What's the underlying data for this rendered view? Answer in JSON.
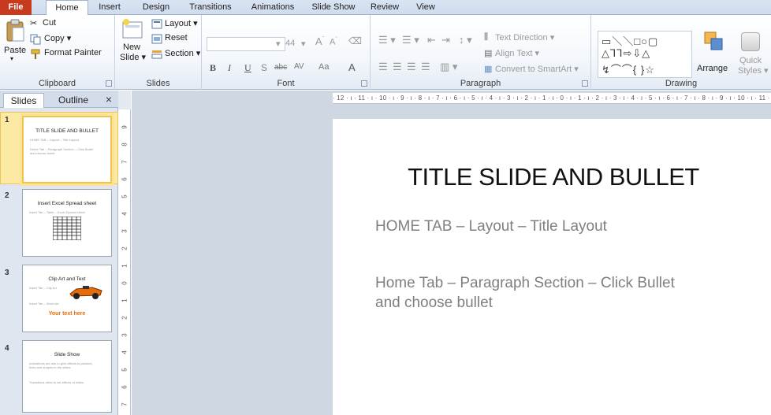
{
  "tabs": [
    "File",
    "Home",
    "Insert",
    "Design",
    "Transitions",
    "Animations",
    "Slide Show",
    "Review",
    "View"
  ],
  "ribbon": {
    "clipboard": {
      "label": "Clipboard",
      "paste": "Paste",
      "cut": "Cut",
      "copy": "Copy ▾",
      "format_painter": "Format Painter"
    },
    "slides": {
      "label": "Slides",
      "new_slide_1": "New",
      "new_slide_2": "Slide ▾",
      "layout": "Layout ▾",
      "reset": "Reset",
      "section": "Section ▾"
    },
    "font": {
      "label": "Font",
      "size": "44",
      "bold": "B",
      "italic": "I",
      "underline": "U",
      "shadow": "S",
      "strike": "abc",
      "spacing": "AV",
      "case": "Aa",
      "color": "A"
    },
    "paragraph": {
      "label": "Paragraph",
      "text_direction": "Text Direction ▾",
      "align_text": "Align Text ▾",
      "convert_smartart": "Convert to SmartArt ▾"
    },
    "drawing": {
      "label": "Drawing",
      "arrange": "Arrange",
      "quick_styles_1": "Quick",
      "quick_styles_2": "Styles ▾"
    }
  },
  "pane": {
    "tab_slides": "Slides",
    "tab_outline": "Outline",
    "close": "×",
    "thumbnails": [
      {
        "num": "1",
        "title": "TITLE SLIDE AND BULLET",
        "line1": "HOME TAB – Layout – Title Layout",
        "line2": "Home Tab – Paragraph Section – Click Bullet",
        "line3": "and choose bullet"
      },
      {
        "num": "2",
        "title": "Insert Excel Spread sheet",
        "line1": "Insert Tab – Table – Excel Spread sheet"
      },
      {
        "num": "3",
        "title": "Clip Art and Text",
        "line1": "Insert Tab – Clip Art",
        "line2": "Insert Tab – Word Art",
        "wordart": "Your text here"
      },
      {
        "num": "4",
        "title": "Slide Show",
        "line1": "Animations are use to give effects to pictures,",
        "line2": "texts and shapes in the slides",
        "line3": "Transitions allow to set effects of slides"
      }
    ]
  },
  "ruler": {
    "horizontal": "· 12 · ı · 11 · ı · 10 · ı · 9 · ı · 8 · ı · 7 · ı · 6 · ı · 5 · ı · 4 · ı · 3 · ı · 2 · ı · 1 · ı · 0 · ı · 1 · ı · 2 · ı · 3 · ı · 4 · ı · 5 · ı · 6 · ı · 7 · ı · 8 · ı · 9 · ı · 10 · ı · 11 ·",
    "vertical": [
      "9",
      "8",
      "7",
      "6",
      "5",
      "4",
      "3",
      "2",
      "1",
      "0",
      "1",
      "2",
      "3",
      "4",
      "5",
      "6",
      "7"
    ]
  },
  "slide": {
    "title": "TITLE SLIDE AND BULLET",
    "bullet1": "HOME TAB – Layout – Title Layout",
    "bullet2_line1": "Home Tab – Paragraph Section – Click Bullet",
    "bullet2_line2": "and choose bullet"
  },
  "colors": {
    "file_tab": "#c83a1d",
    "selection": "#f2c44b",
    "wordart": "#e46c0a"
  }
}
